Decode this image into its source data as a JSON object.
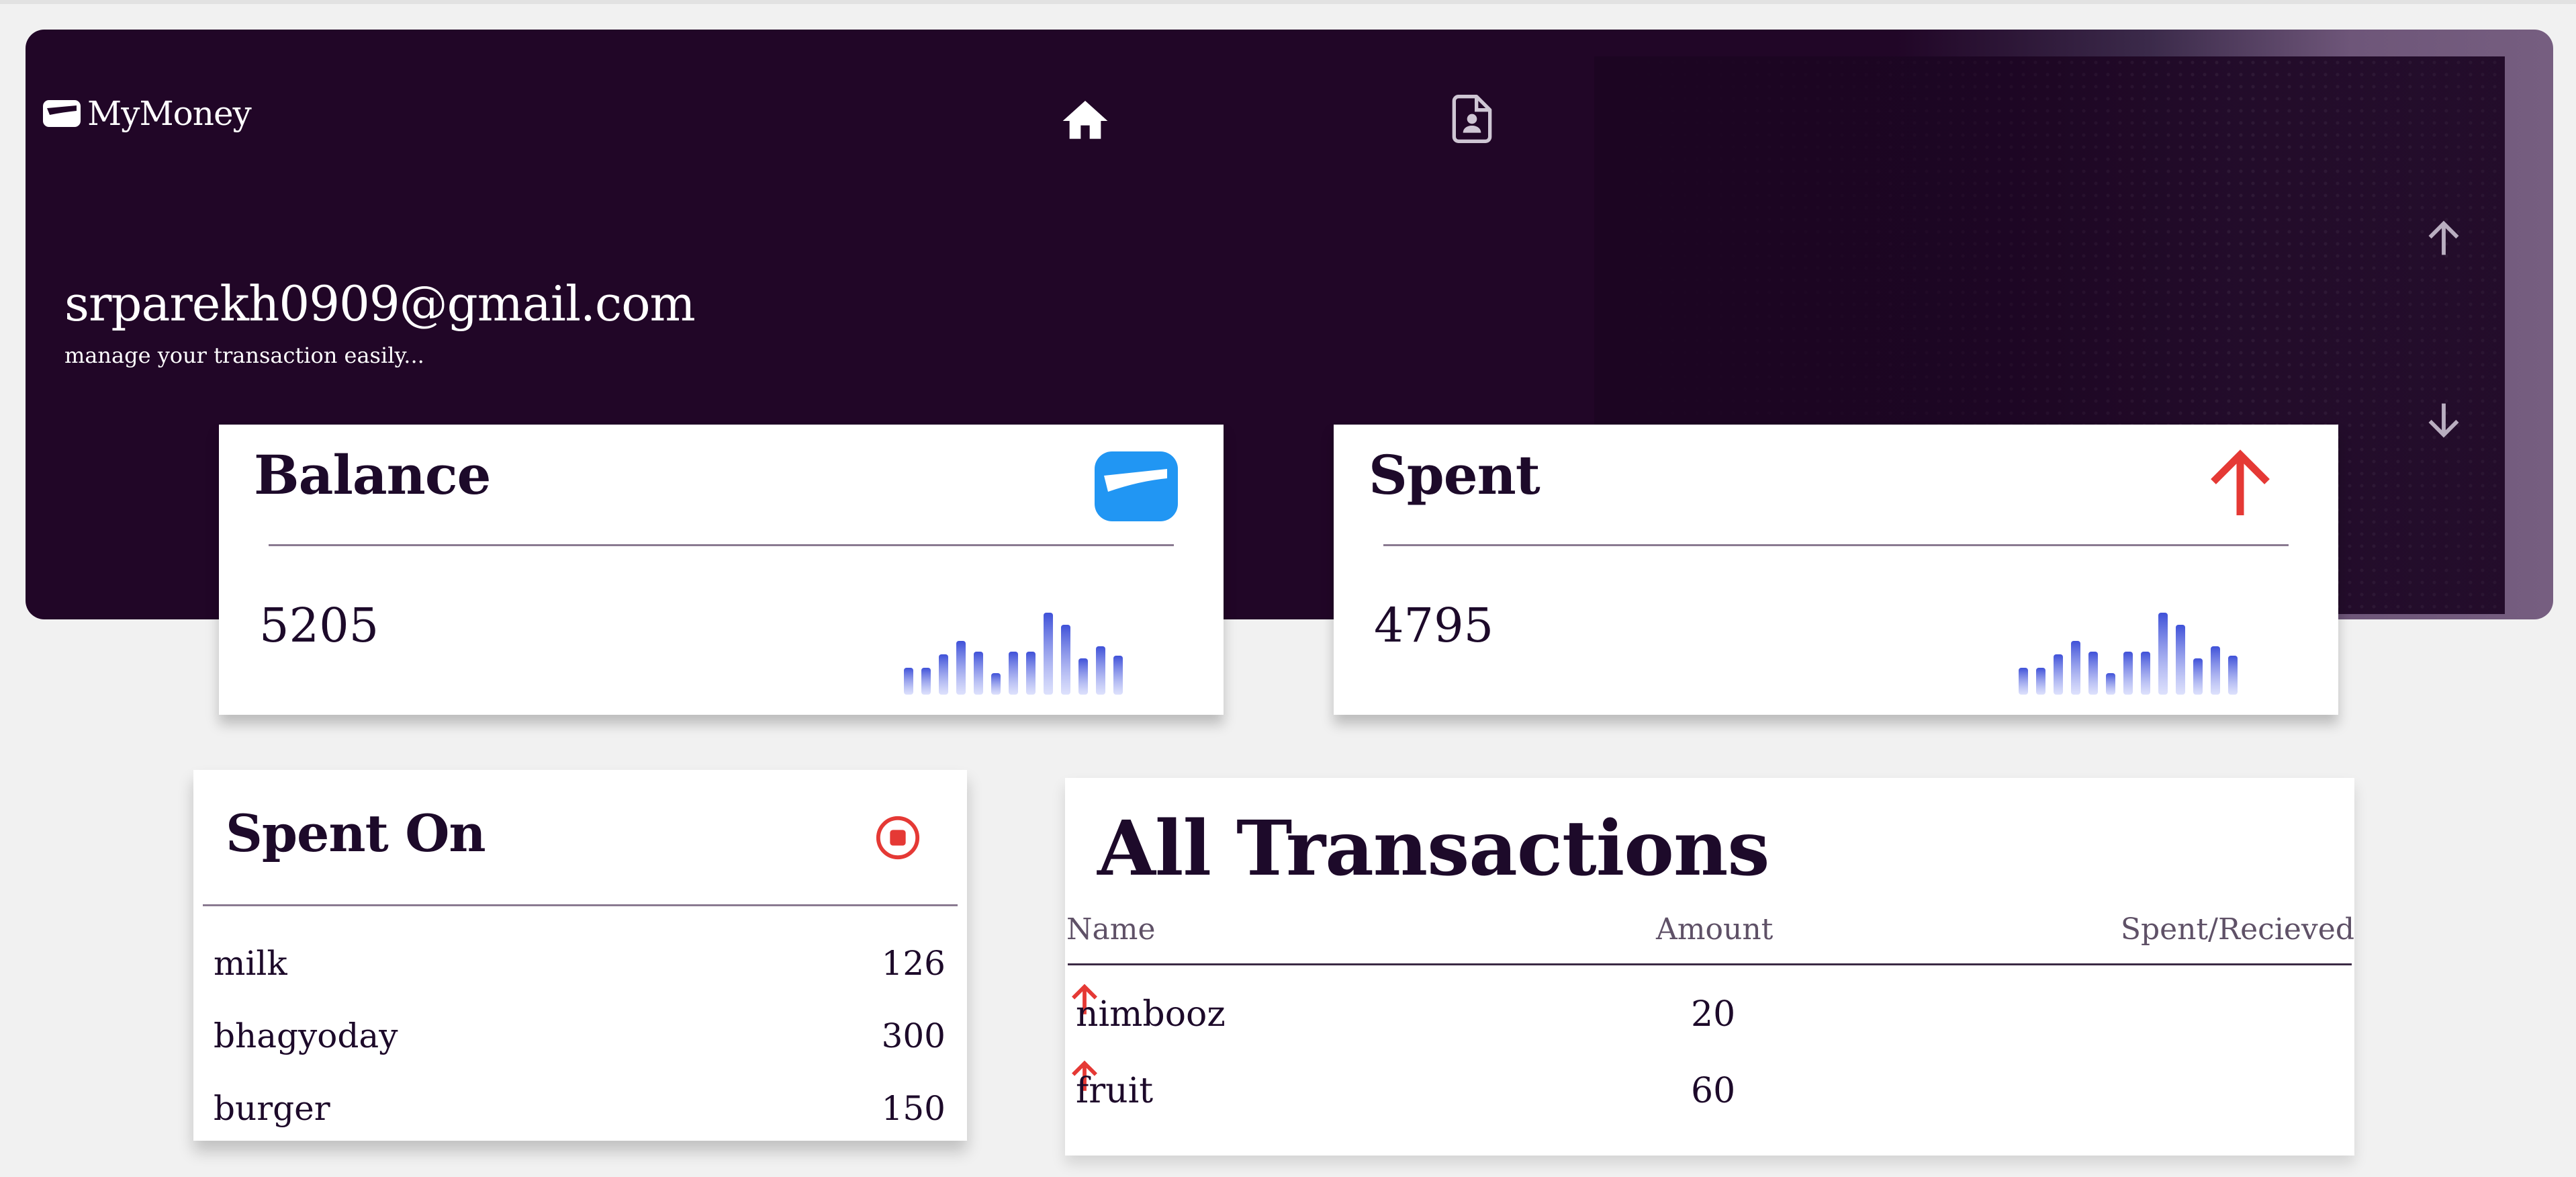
{
  "app": {
    "name": "MyMoney"
  },
  "user": {
    "email": "srparekh0909@gmail.com",
    "tagline": "manage your transaction easily..."
  },
  "icons": {
    "logo": "wallet-icon",
    "home": "home-icon",
    "profile": "contact-document-icon",
    "received": "arrow-up-icon",
    "spent": "arrow-down-icon",
    "stop": "stop-circle-icon"
  },
  "cards": {
    "balance": {
      "title": "Balance",
      "value": "5205",
      "icon": "wallet-icon"
    },
    "spent": {
      "title": "Spent",
      "value": "4795",
      "icon": "arrow-up-icon"
    }
  },
  "spent_on": {
    "title": "Spent On",
    "items": [
      {
        "name": "milk",
        "amount": "126"
      },
      {
        "name": "bhagyoday",
        "amount": "300"
      },
      {
        "name": "burger",
        "amount": "150"
      }
    ]
  },
  "transactions": {
    "title": "All Transactions",
    "columns": {
      "name": "Name",
      "amount": "Amount",
      "direction": "Spent/Recieved"
    },
    "rows": [
      {
        "name": "nimbooz",
        "amount": "20",
        "direction": "arrow-up-icon"
      },
      {
        "name": "fruit",
        "amount": "60",
        "direction": "arrow-up-icon"
      }
    ]
  },
  "colors": {
    "banner": "#210627",
    "accent_blue": "#2196f3",
    "accent_red": "#e53935",
    "text_dark": "#1d0a2a"
  }
}
